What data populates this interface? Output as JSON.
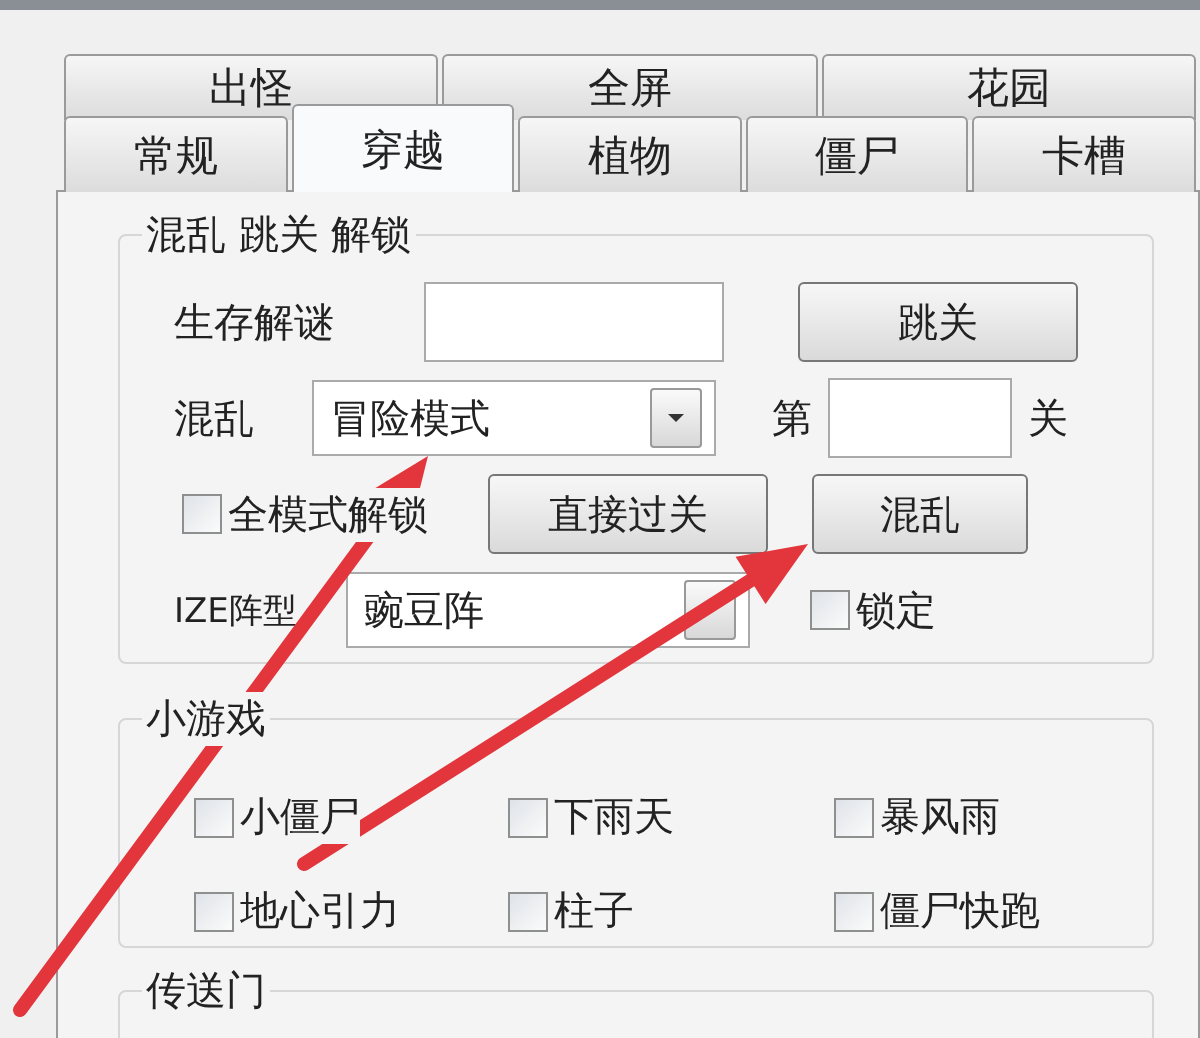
{
  "tab_rows": [
    [
      {
        "label": "出怪",
        "selected": false
      },
      {
        "label": "全屏",
        "selected": false
      },
      {
        "label": "花园",
        "selected": false
      }
    ],
    [
      {
        "label": "常规",
        "selected": false
      },
      {
        "label": "穿越",
        "selected": true
      },
      {
        "label": "植物",
        "selected": false
      },
      {
        "label": "僵尸",
        "selected": false
      },
      {
        "label": "卡槽",
        "selected": false
      }
    ]
  ],
  "unlock_group": {
    "title": "混乱 跳关 解锁",
    "survival_label": "生存解谜",
    "jump_button": "跳关",
    "chaos_label": "混乱",
    "mode_select": "冒险模式",
    "level_prefix": "第",
    "level_suffix": "关",
    "all_modes": {
      "label": "全模式解锁",
      "checked": false
    },
    "pass_button": "直接过关",
    "chaos_button": "混乱",
    "formation_label": "IZE阵型",
    "formation_select": "豌豆阵",
    "lock": {
      "label": "锁定",
      "checked": false
    }
  },
  "minigame_group": {
    "title": "小游戏",
    "items": [
      {
        "label": "小僵尸",
        "checked": false
      },
      {
        "label": "下雨天",
        "checked": false
      },
      {
        "label": "暴风雨",
        "checked": false
      },
      {
        "label": "地心引力",
        "checked": false
      },
      {
        "label": "柱子",
        "checked": false
      },
      {
        "label": "僵尸快跑",
        "checked": false
      }
    ]
  },
  "portal_group": {
    "title": "传送门"
  },
  "annotations": [
    {
      "kind": "arrow"
    },
    {
      "kind": "arrow"
    }
  ]
}
